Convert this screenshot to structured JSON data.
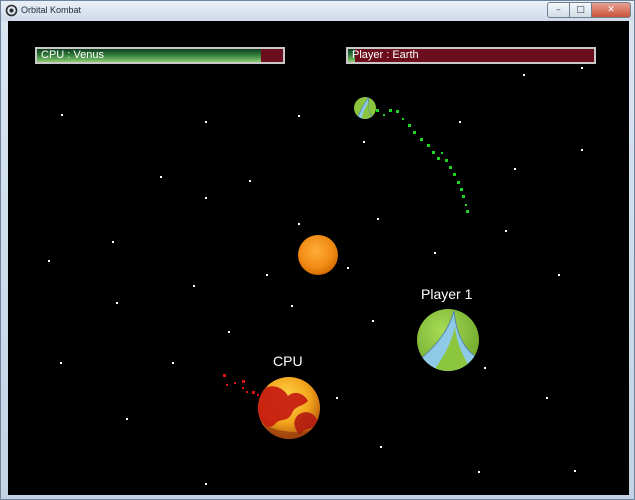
{
  "window": {
    "title": "Orbital Kombat",
    "minimize_icon": "minimize-icon",
    "maximize_icon": "maximize-icon",
    "close_icon": "close-icon"
  },
  "hud": {
    "cpu_bar": {
      "label": "CPU : Venus",
      "health_fraction": 0.91
    },
    "player_bar": {
      "label": "Player : Earth",
      "health_fraction": 0.03
    }
  },
  "planets": {
    "cpu": {
      "label": "CPU",
      "name": "Venus"
    },
    "player": {
      "label": "Player 1",
      "name": "Earth"
    }
  },
  "colors": {
    "space": "#000000",
    "health_full": "#2f7a3a",
    "health_empty": "#6b0d1c",
    "sun": "#f08a12",
    "earth_land": "#8cc63f",
    "earth_water": "#8ec9e8",
    "venus": "#f2a41b",
    "cpu_projectile": "#e01010",
    "player_projectile": "#22d422"
  }
}
